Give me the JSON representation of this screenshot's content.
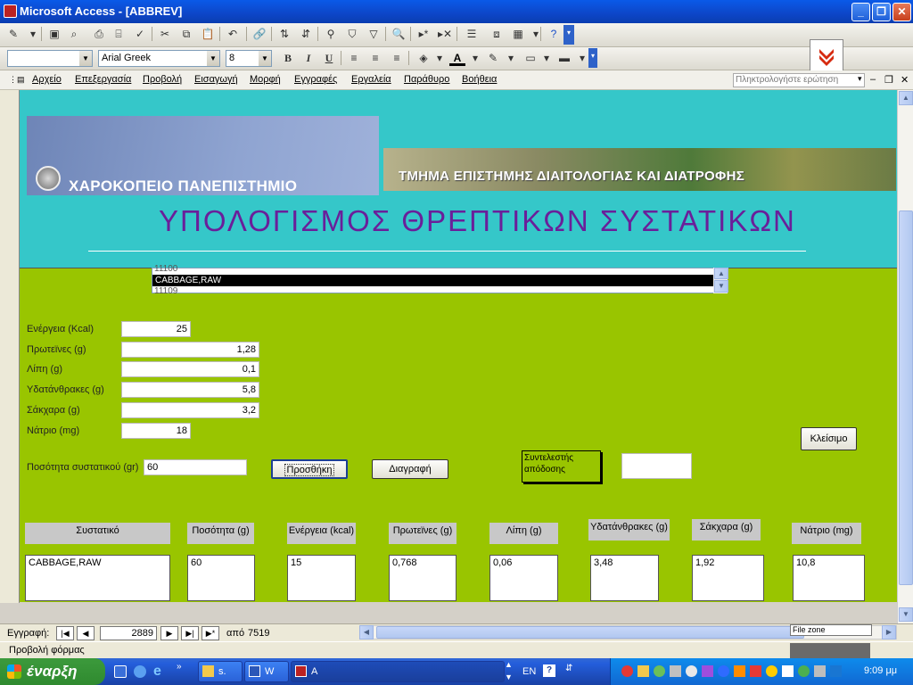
{
  "window": {
    "title": "Microsoft Access - [ABBREV]"
  },
  "toolbar2": {
    "style_value": "",
    "font_name": "Arial Greek",
    "font_size": "8",
    "bold": "B",
    "italic": "I",
    "underline": "U"
  },
  "menu": {
    "items": [
      "Αρχείο",
      "Επεξεργασία",
      "Προβολή",
      "Εισαγωγή",
      "Μορφή",
      "Εγγραφές",
      "Εργαλεία",
      "Παράθυρο",
      "Βοήθεια"
    ],
    "help_placeholder": "Πληκτρολογήστε ερώτηση"
  },
  "header": {
    "university": "ΧΑΡΟΚΟΠΕΙΟ ΠΑΝΕΠΙΣΤΗΜΙΟ",
    "department": "ΤΜΗΜΑ ΕΠΙΣΤΗΜΗΣ ΔΙΑΙΤΟΛΟΓΙΑΣ ΚΑΙ ΔΙΑΤΡΟΦΗΣ",
    "title": "ΥΠΟΛΟΓΙΣΜΟΣ ΘΡΕΠΤΙΚΩΝ ΣΥΣΤΑΤΙΚΩΝ"
  },
  "listbox": {
    "above": "11100",
    "selected": "CABBAGE,RAW",
    "below": "11109"
  },
  "nutrients": [
    {
      "label": "Ενέργεια (Kcal)",
      "value": "25"
    },
    {
      "label": "Πρωτεϊνες (g)",
      "value": "1,28"
    },
    {
      "label": "Λίπη (g)",
      "value": "0,1"
    },
    {
      "label": "Υδατάνθρακες (g)",
      "value": "5,8"
    },
    {
      "label": "Σάκχαρα (g)",
      "value": "3,2"
    },
    {
      "label": "Νάτριο (mg)",
      "value": "18"
    }
  ],
  "quantity": {
    "label": "Ποσότητα συστατικού (gr)",
    "value": "60"
  },
  "buttons": {
    "add": "Προσθήκη",
    "delete": "Διαγραφή",
    "close": "Κλείσιμο"
  },
  "yield": {
    "label": "Συντελεστής απόδοσης",
    "value": ""
  },
  "table": {
    "headers": [
      "Συστατικό",
      "Ποσότητα (g)",
      "Ενέργεια (kcal)",
      "Πρωτεϊνες (g)",
      "Λίπη (g)",
      "Υδατάνθρακες (g)",
      "Σάκχαρα (g)",
      "Νάτριο (mg)"
    ],
    "row": [
      "CABBAGE,RAW",
      "60",
      "15",
      "0,768",
      "0,06",
      "3,48",
      "1,92",
      "10,8"
    ]
  },
  "navigation": {
    "label": "Εγγραφή:",
    "current": "2889",
    "of_label": "από",
    "total": "7519",
    "zone": "File zone"
  },
  "status": {
    "text": "Προβολή φόρμας"
  },
  "taskbar": {
    "start": "έναρξη",
    "tasks": [
      "s.",
      "W",
      "A"
    ],
    "lang": "EN",
    "clock": "9:09 μμ"
  }
}
